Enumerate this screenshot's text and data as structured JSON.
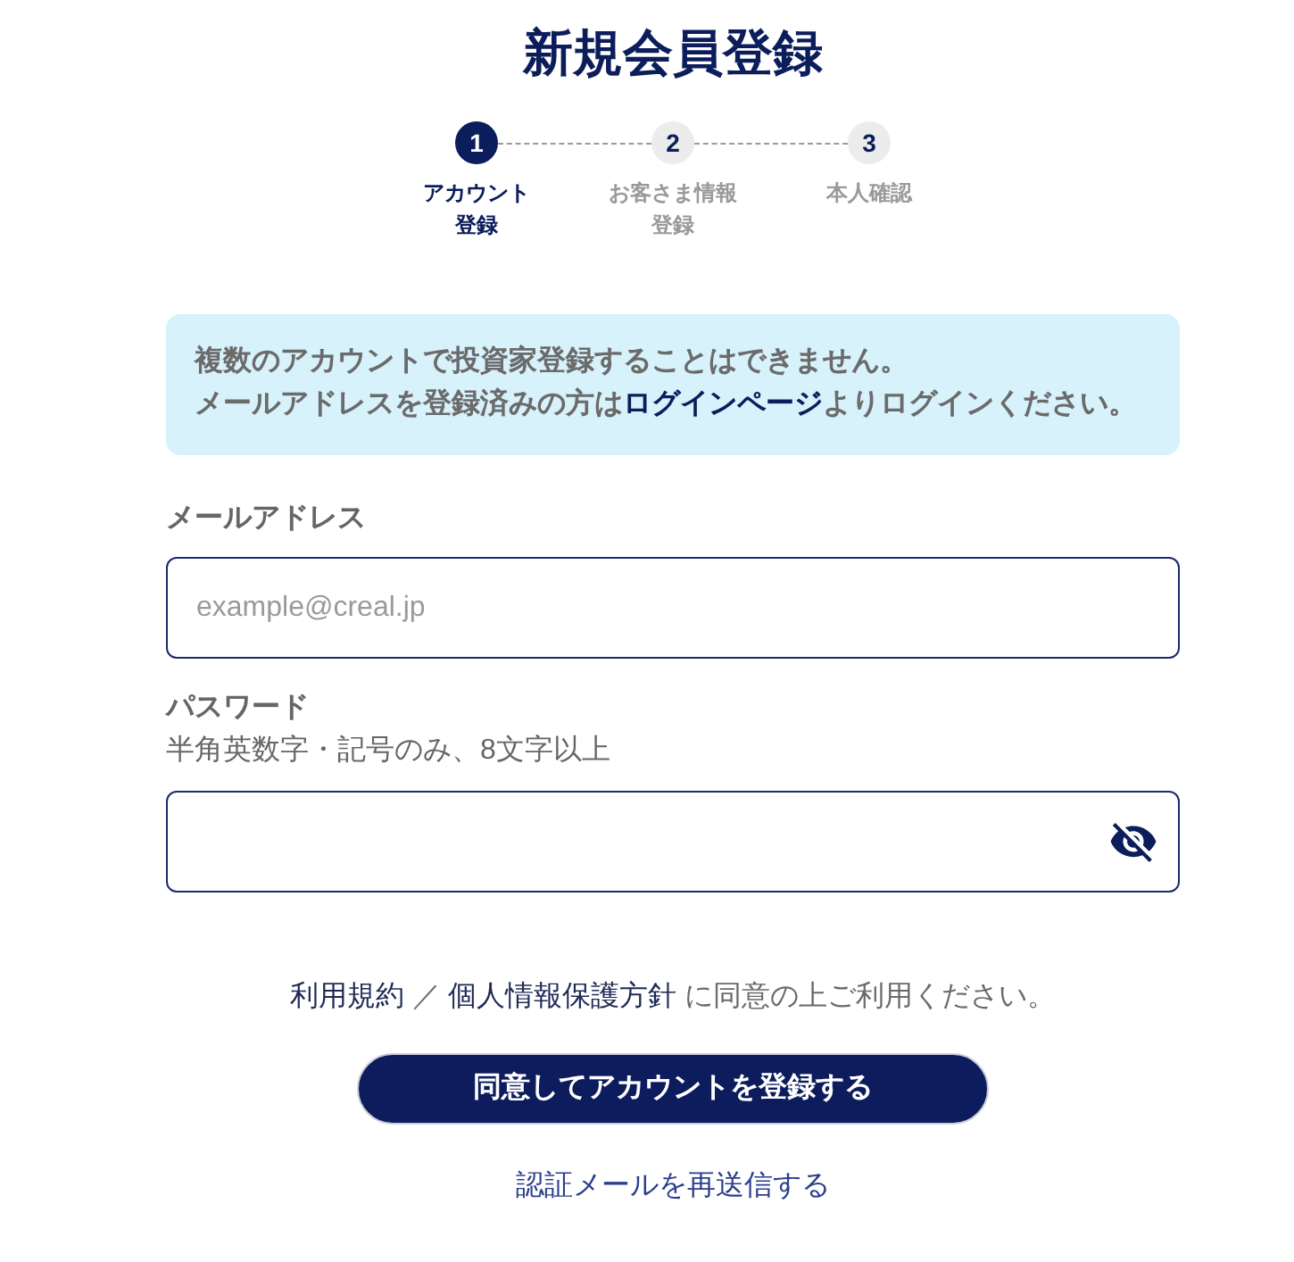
{
  "page": {
    "title": "新規会員登録"
  },
  "steps": [
    {
      "number": "1",
      "label_lines": [
        "アカウント",
        "登録"
      ],
      "selected": true
    },
    {
      "number": "2",
      "label_lines": [
        "お客さま情報",
        "登録"
      ],
      "selected": false
    },
    {
      "number": "3",
      "label_lines": [
        "本人確認"
      ],
      "selected": false
    }
  ],
  "notice": {
    "lines": [
      [
        {
          "kind": "text",
          "text": "複数のアカウントで投資家登録することはできません。"
        }
      ],
      [
        {
          "kind": "text",
          "text": "メールアドレスを登録済みの方は"
        },
        {
          "kind": "link",
          "text": "ログインページ"
        },
        {
          "kind": "text",
          "text": "よりログインください。"
        }
      ]
    ]
  },
  "form": {
    "fields": [
      {
        "kind": "email",
        "label": "メールアドレス",
        "placeholder": "example@creal.jp"
      },
      {
        "kind": "password",
        "label": "パスワード",
        "hint": "半角英数字・記号のみ、8文字以上",
        "revealed": false
      }
    ]
  },
  "agreement": [
    {
      "kind": "link",
      "text": "利用規約"
    },
    {
      "kind": "text",
      "text": "／"
    },
    {
      "kind": "link",
      "text": "個人情報保護方針"
    },
    {
      "kind": "text",
      "text": "に同意の上ご利用ください。"
    }
  ],
  "submit_button": {
    "label": "同意してアカウントを登録する"
  },
  "resend_link": {
    "label": "認証メールを再送信する"
  }
}
